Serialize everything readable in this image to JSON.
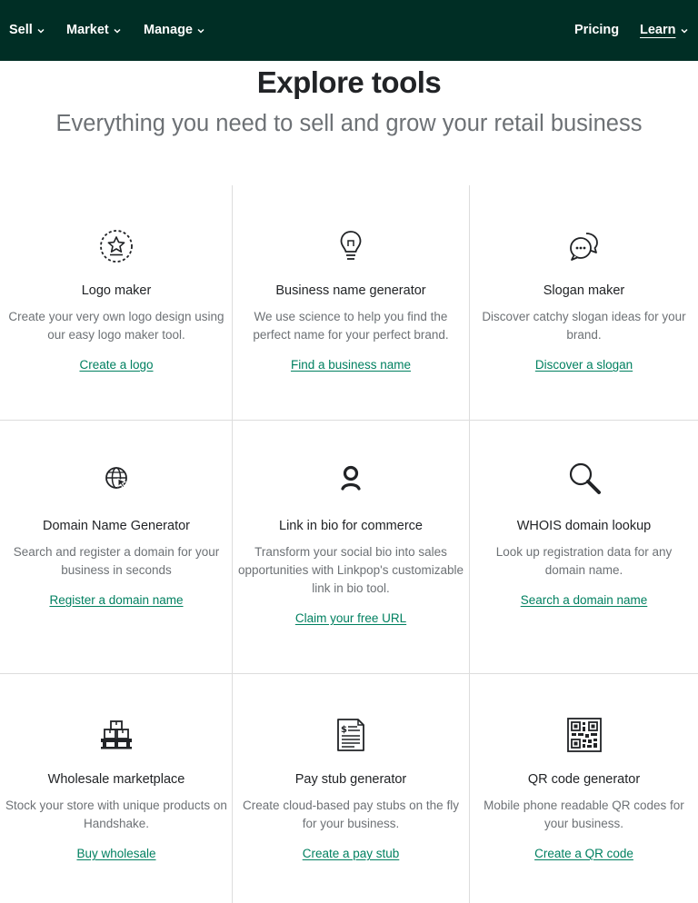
{
  "nav": {
    "sell": "Sell",
    "market": "Market",
    "manage": "Manage",
    "pricing": "Pricing",
    "learn": "Learn"
  },
  "heading": "Explore tools",
  "subheading": "Everything you need to sell and grow your retail business",
  "tools": [
    {
      "title": "Logo maker",
      "desc": "Create your very own logo design using our easy logo maker tool.",
      "link": "Create a logo",
      "icon": "star-badge-icon"
    },
    {
      "title": "Business name generator",
      "desc": "We use science to help you find the perfect name for your perfect brand.",
      "link": "Find a business name",
      "icon": "lightbulb-icon"
    },
    {
      "title": "Slogan maker",
      "desc": "Discover catchy slogan ideas for your brand.",
      "link": "Discover a slogan",
      "icon": "chat-bubbles-icon"
    },
    {
      "title": "Domain Name Generator",
      "desc": "Search and register a domain for your business in seconds",
      "link": "Register a domain name",
      "icon": "globe-cursor-icon"
    },
    {
      "title": "Link in bio for commerce",
      "desc": "Transform your social bio into sales opportunities with Linkpop's customizable link in bio tool.",
      "link": "Claim your free URL",
      "icon": "linkpop-icon"
    },
    {
      "title": "WHOIS domain lookup",
      "desc": "Look up registration data for any domain name.",
      "link": "Search a domain name",
      "icon": "magnifier-icon"
    },
    {
      "title": "Wholesale marketplace",
      "desc": "Stock your store with unique products on Handshake.",
      "link": "Buy wholesale",
      "icon": "pallet-boxes-icon"
    },
    {
      "title": "Pay stub generator",
      "desc": "Create cloud-based pay stubs on the fly for your business.",
      "link": "Create a pay stub",
      "icon": "pay-stub-icon"
    },
    {
      "title": "QR code generator",
      "desc": "Mobile phone readable QR codes for your business.",
      "link": "Create a QR code",
      "icon": "qr-code-icon"
    }
  ],
  "colors": {
    "nav_bg": "#002e25",
    "link": "#008060",
    "text": "#212326",
    "muted": "#6d7175"
  }
}
